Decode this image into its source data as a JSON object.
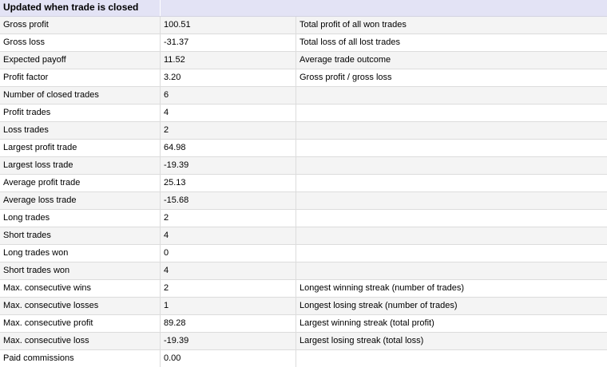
{
  "panel": {
    "header": "Updated when trade is closed"
  },
  "rows": [
    {
      "label": "Gross profit",
      "value": "100.51",
      "desc": "Total profit of all won trades"
    },
    {
      "label": "Gross loss",
      "value": "-31.37",
      "desc": "Total loss of all lost trades"
    },
    {
      "label": "Expected payoff",
      "value": "11.52",
      "desc": "Average trade outcome"
    },
    {
      "label": "Profit factor",
      "value": "3.20",
      "desc": "Gross profit / gross loss"
    },
    {
      "label": "Number of closed trades",
      "value": "6",
      "desc": ""
    },
    {
      "label": "Profit trades",
      "value": "4",
      "desc": ""
    },
    {
      "label": "Loss trades",
      "value": "2",
      "desc": ""
    },
    {
      "label": "Largest profit trade",
      "value": "64.98",
      "desc": ""
    },
    {
      "label": "Largest loss trade",
      "value": "-19.39",
      "desc": ""
    },
    {
      "label": "Average profit trade",
      "value": "25.13",
      "desc": ""
    },
    {
      "label": "Average loss trade",
      "value": "-15.68",
      "desc": ""
    },
    {
      "label": "Long trades",
      "value": "2",
      "desc": ""
    },
    {
      "label": "Short trades",
      "value": "4",
      "desc": ""
    },
    {
      "label": "Long trades won",
      "value": "0",
      "desc": ""
    },
    {
      "label": "Short trades won",
      "value": "4",
      "desc": ""
    },
    {
      "label": "Max. consecutive wins",
      "value": "2",
      "desc": "Longest winning streak (number of trades)"
    },
    {
      "label": "Max. consecutive losses",
      "value": "1",
      "desc": "Longest losing streak (number of trades)"
    },
    {
      "label": "Max. consecutive profit",
      "value": "89.28",
      "desc": "Largest winning streak (total profit)"
    },
    {
      "label": "Max. consecutive loss",
      "value": "-19.39",
      "desc": "Largest losing streak (total loss)"
    },
    {
      "label": "Paid commissions",
      "value": "0.00",
      "desc": ""
    }
  ]
}
